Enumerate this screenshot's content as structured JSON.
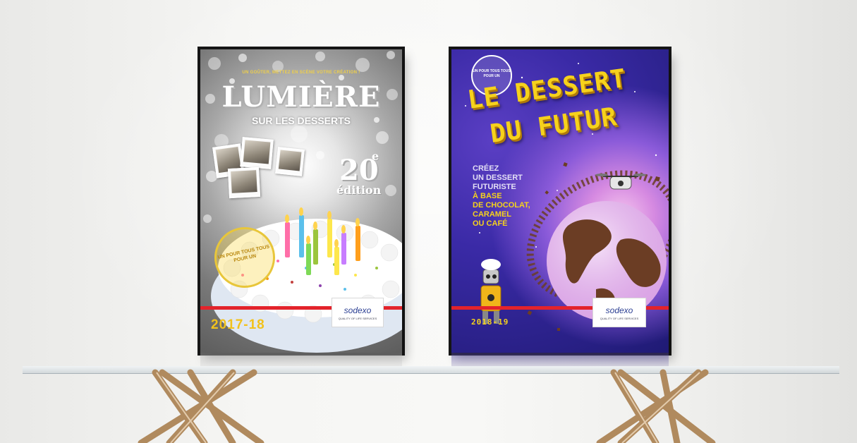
{
  "scene": {
    "wall_color": "#f3f3f1",
    "shelf": "glass shelf on brass legs",
    "leg_color": "#a9825a"
  },
  "poster_left": {
    "tagline": "UN GOÛTER, METTEZ EN SCÈNE VOTRE CRÉATION !",
    "title": "LUMIÈRE",
    "subtitle": "SUR LES DESSERTS",
    "edition_number": "20",
    "edition_suffix": "e",
    "edition_word": "édition",
    "stamp_text": "UN POUR TOUS TOUS POUR UN",
    "year": "2017-18",
    "logo": "sodexo",
    "logo_sub": "QUALITY OF LIFE SERVICES",
    "accent": "#e3232b",
    "year_color": "#f2c21b"
  },
  "poster_right": {
    "badge_text": "UN POUR TOUS TOUS POUR UN",
    "title_line1": "LE DESSERT",
    "title_line2": "DU FUTUR",
    "body_lines": [
      {
        "text": "CRÉEZ",
        "style": "white"
      },
      {
        "text": "UN DESSERT",
        "style": "white"
      },
      {
        "text": "FUTURISTE",
        "style": "white"
      },
      {
        "text": "À BASE",
        "style": "yellow"
      },
      {
        "text": "DE CHOCOLAT,",
        "style": "yellow"
      },
      {
        "text": "CARAMEL",
        "style": "yellow"
      },
      {
        "text": "OU CAFÉ",
        "style": "yellow"
      }
    ],
    "year": "2018-19",
    "logo": "sodexo",
    "logo_sub": "QUALITY OF LIFE SERVICES",
    "title_color": "#f6d21c",
    "accent": "#e3232b"
  }
}
